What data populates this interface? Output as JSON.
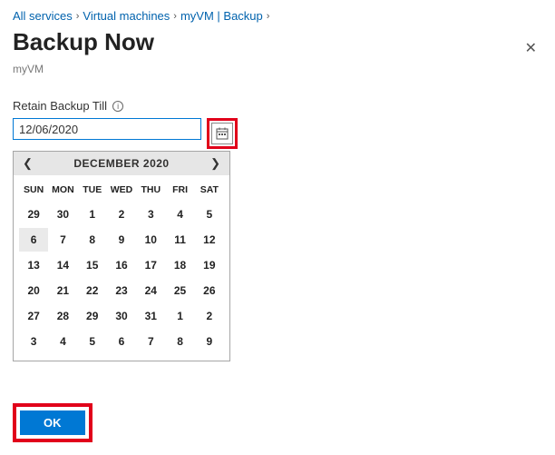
{
  "breadcrumbs": {
    "items": [
      "All services",
      "Virtual machines",
      "myVM | Backup"
    ]
  },
  "header": {
    "title": "Backup Now",
    "subtitle": "myVM",
    "close_glyph": "✕"
  },
  "field": {
    "label": "Retain Backup Till",
    "info_glyph": "i",
    "value": "12/06/2020"
  },
  "calendar": {
    "prev_glyph": "❮",
    "next_glyph": "❯",
    "title": "DECEMBER 2020",
    "dow": [
      "SUN",
      "MON",
      "TUE",
      "WED",
      "THU",
      "FRI",
      "SAT"
    ],
    "weeks": [
      [
        {
          "d": "29",
          "other": true
        },
        {
          "d": "30",
          "other": true
        },
        {
          "d": "1"
        },
        {
          "d": "2"
        },
        {
          "d": "3"
        },
        {
          "d": "4"
        },
        {
          "d": "5"
        }
      ],
      [
        {
          "d": "6",
          "selected": true
        },
        {
          "d": "7"
        },
        {
          "d": "8"
        },
        {
          "d": "9"
        },
        {
          "d": "10"
        },
        {
          "d": "11"
        },
        {
          "d": "12"
        }
      ],
      [
        {
          "d": "13"
        },
        {
          "d": "14"
        },
        {
          "d": "15"
        },
        {
          "d": "16"
        },
        {
          "d": "17"
        },
        {
          "d": "18"
        },
        {
          "d": "19"
        }
      ],
      [
        {
          "d": "20"
        },
        {
          "d": "21"
        },
        {
          "d": "22"
        },
        {
          "d": "23"
        },
        {
          "d": "24"
        },
        {
          "d": "25"
        },
        {
          "d": "26"
        }
      ],
      [
        {
          "d": "27"
        },
        {
          "d": "28"
        },
        {
          "d": "29"
        },
        {
          "d": "30"
        },
        {
          "d": "31"
        },
        {
          "d": "1",
          "other": true
        },
        {
          "d": "2",
          "other": true
        }
      ],
      [
        {
          "d": "3",
          "other": true
        },
        {
          "d": "4",
          "other": true
        },
        {
          "d": "5",
          "other": true
        },
        {
          "d": "6",
          "other": true
        },
        {
          "d": "7",
          "other": true
        },
        {
          "d": "8",
          "other": true
        },
        {
          "d": "9",
          "other": true
        }
      ]
    ]
  },
  "footer": {
    "ok_label": "OK"
  },
  "icons": {
    "calendar_svg": "cal"
  }
}
